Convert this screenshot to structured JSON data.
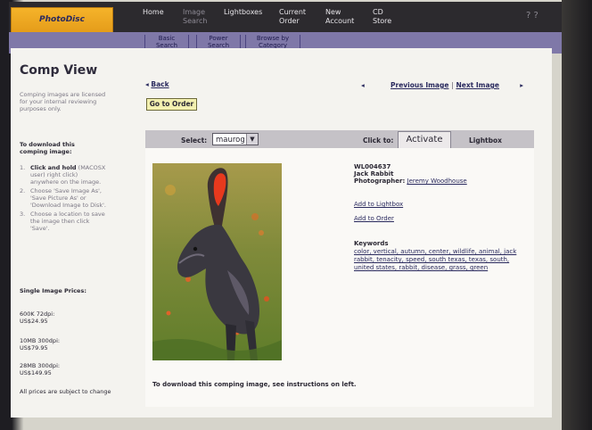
{
  "header": {
    "logo": "PhotoDisc",
    "nav": [
      {
        "label": "Home",
        "dim": false
      },
      {
        "label": "Image Search",
        "dim": true
      },
      {
        "label": "Lightboxes",
        "dim": false
      },
      {
        "label": "Current Order",
        "dim": false
      },
      {
        "label": "New Account",
        "dim": false
      },
      {
        "label": "CD Store",
        "dim": false
      }
    ],
    "icons": "? ?"
  },
  "subnav": [
    "Basic Search",
    "Power Search",
    "Browse by Category"
  ],
  "page": {
    "title": "Comp View",
    "comp_note": "Comping images are licensed for your internal reviewing purposes only.",
    "download_title": "To download this comping image:",
    "steps": [
      {
        "strong": "Click and hold",
        "text": "(MACOSX user) right click) anywhere on the image."
      },
      {
        "strong": "",
        "text": "Choose 'Save Image As', 'Save Picture As' or 'Download Image to Disk'."
      },
      {
        "strong": "",
        "text": "Choose a location to save the image then click 'Save'."
      }
    ],
    "prices_title": "Single Image Prices:",
    "prices": [
      {
        "size": "600K 72dpi:",
        "price": "US$24.95"
      },
      {
        "size": "10MB 300dpi:",
        "price": "US$79.95"
      },
      {
        "size": "28MB 300dpi:",
        "price": "US$149.95"
      }
    ],
    "price_note": "All prices are subject to change"
  },
  "main": {
    "back": "Back",
    "go_to_order": "Go to Order",
    "previous": "Previous Image",
    "next": "Next Image",
    "sep": "|",
    "select_label": "Select:",
    "select_value": "maurog",
    "click_to": "Click to:",
    "activate": "Activate",
    "lightbox": "Lightbox",
    "image_id": "WL004637",
    "image_title": "Jack Rabbit",
    "photographer_label": "Photographer:",
    "photographer": "Jeremy Woodhouse",
    "add_lightbox": "Add to Lightbox",
    "add_order": "Add to Order",
    "keywords_label": "Keywords",
    "keywords": "color, vertical, autumn, center, wildlife, animal, jack rabbit, tenacity, speed, south texas, texas, south, united states, rabbit, disease, grass, green",
    "dl_note": "To download this comping image, see instructions on left."
  },
  "colors": {
    "accent": "#2a2a5e",
    "logo_bg": "#f0a924",
    "subnav": "#7f78a8"
  }
}
